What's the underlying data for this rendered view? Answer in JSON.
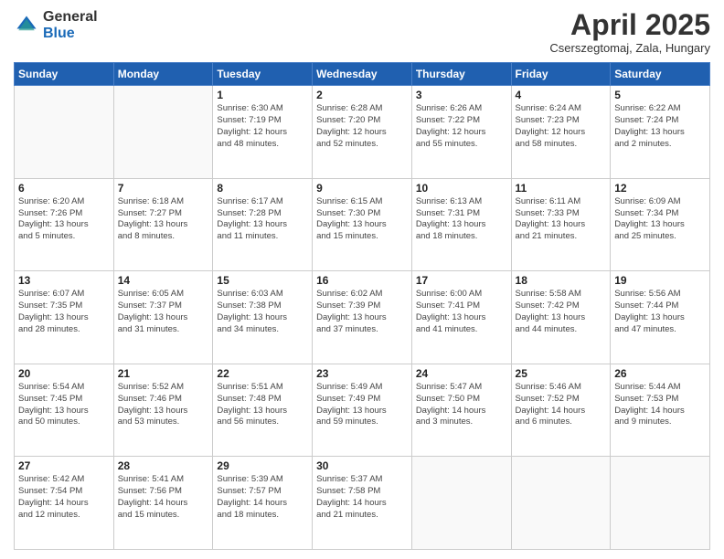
{
  "logo": {
    "general": "General",
    "blue": "Blue"
  },
  "header": {
    "title": "April 2025",
    "subtitle": "Cserszegtomaj, Zala, Hungary"
  },
  "weekdays": [
    "Sunday",
    "Monday",
    "Tuesday",
    "Wednesday",
    "Thursday",
    "Friday",
    "Saturday"
  ],
  "weeks": [
    [
      {
        "day": "",
        "info": ""
      },
      {
        "day": "",
        "info": ""
      },
      {
        "day": "1",
        "info": "Sunrise: 6:30 AM\nSunset: 7:19 PM\nDaylight: 12 hours\nand 48 minutes."
      },
      {
        "day": "2",
        "info": "Sunrise: 6:28 AM\nSunset: 7:20 PM\nDaylight: 12 hours\nand 52 minutes."
      },
      {
        "day": "3",
        "info": "Sunrise: 6:26 AM\nSunset: 7:22 PM\nDaylight: 12 hours\nand 55 minutes."
      },
      {
        "day": "4",
        "info": "Sunrise: 6:24 AM\nSunset: 7:23 PM\nDaylight: 12 hours\nand 58 minutes."
      },
      {
        "day": "5",
        "info": "Sunrise: 6:22 AM\nSunset: 7:24 PM\nDaylight: 13 hours\nand 2 minutes."
      }
    ],
    [
      {
        "day": "6",
        "info": "Sunrise: 6:20 AM\nSunset: 7:26 PM\nDaylight: 13 hours\nand 5 minutes."
      },
      {
        "day": "7",
        "info": "Sunrise: 6:18 AM\nSunset: 7:27 PM\nDaylight: 13 hours\nand 8 minutes."
      },
      {
        "day": "8",
        "info": "Sunrise: 6:17 AM\nSunset: 7:28 PM\nDaylight: 13 hours\nand 11 minutes."
      },
      {
        "day": "9",
        "info": "Sunrise: 6:15 AM\nSunset: 7:30 PM\nDaylight: 13 hours\nand 15 minutes."
      },
      {
        "day": "10",
        "info": "Sunrise: 6:13 AM\nSunset: 7:31 PM\nDaylight: 13 hours\nand 18 minutes."
      },
      {
        "day": "11",
        "info": "Sunrise: 6:11 AM\nSunset: 7:33 PM\nDaylight: 13 hours\nand 21 minutes."
      },
      {
        "day": "12",
        "info": "Sunrise: 6:09 AM\nSunset: 7:34 PM\nDaylight: 13 hours\nand 25 minutes."
      }
    ],
    [
      {
        "day": "13",
        "info": "Sunrise: 6:07 AM\nSunset: 7:35 PM\nDaylight: 13 hours\nand 28 minutes."
      },
      {
        "day": "14",
        "info": "Sunrise: 6:05 AM\nSunset: 7:37 PM\nDaylight: 13 hours\nand 31 minutes."
      },
      {
        "day": "15",
        "info": "Sunrise: 6:03 AM\nSunset: 7:38 PM\nDaylight: 13 hours\nand 34 minutes."
      },
      {
        "day": "16",
        "info": "Sunrise: 6:02 AM\nSunset: 7:39 PM\nDaylight: 13 hours\nand 37 minutes."
      },
      {
        "day": "17",
        "info": "Sunrise: 6:00 AM\nSunset: 7:41 PM\nDaylight: 13 hours\nand 41 minutes."
      },
      {
        "day": "18",
        "info": "Sunrise: 5:58 AM\nSunset: 7:42 PM\nDaylight: 13 hours\nand 44 minutes."
      },
      {
        "day": "19",
        "info": "Sunrise: 5:56 AM\nSunset: 7:44 PM\nDaylight: 13 hours\nand 47 minutes."
      }
    ],
    [
      {
        "day": "20",
        "info": "Sunrise: 5:54 AM\nSunset: 7:45 PM\nDaylight: 13 hours\nand 50 minutes."
      },
      {
        "day": "21",
        "info": "Sunrise: 5:52 AM\nSunset: 7:46 PM\nDaylight: 13 hours\nand 53 minutes."
      },
      {
        "day": "22",
        "info": "Sunrise: 5:51 AM\nSunset: 7:48 PM\nDaylight: 13 hours\nand 56 minutes."
      },
      {
        "day": "23",
        "info": "Sunrise: 5:49 AM\nSunset: 7:49 PM\nDaylight: 13 hours\nand 59 minutes."
      },
      {
        "day": "24",
        "info": "Sunrise: 5:47 AM\nSunset: 7:50 PM\nDaylight: 14 hours\nand 3 minutes."
      },
      {
        "day": "25",
        "info": "Sunrise: 5:46 AM\nSunset: 7:52 PM\nDaylight: 14 hours\nand 6 minutes."
      },
      {
        "day": "26",
        "info": "Sunrise: 5:44 AM\nSunset: 7:53 PM\nDaylight: 14 hours\nand 9 minutes."
      }
    ],
    [
      {
        "day": "27",
        "info": "Sunrise: 5:42 AM\nSunset: 7:54 PM\nDaylight: 14 hours\nand 12 minutes."
      },
      {
        "day": "28",
        "info": "Sunrise: 5:41 AM\nSunset: 7:56 PM\nDaylight: 14 hours\nand 15 minutes."
      },
      {
        "day": "29",
        "info": "Sunrise: 5:39 AM\nSunset: 7:57 PM\nDaylight: 14 hours\nand 18 minutes."
      },
      {
        "day": "30",
        "info": "Sunrise: 5:37 AM\nSunset: 7:58 PM\nDaylight: 14 hours\nand 21 minutes."
      },
      {
        "day": "",
        "info": ""
      },
      {
        "day": "",
        "info": ""
      },
      {
        "day": "",
        "info": ""
      }
    ]
  ]
}
